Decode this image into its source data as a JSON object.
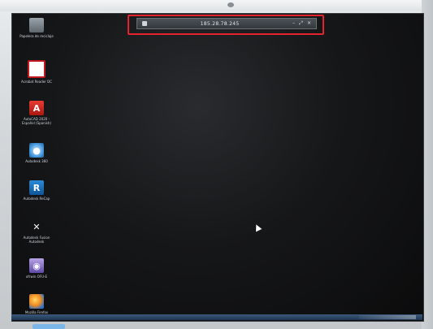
{
  "remote_bar": {
    "title": "185.28.78.245",
    "pin_label": "",
    "controls": [
      "–",
      "⤢",
      "×"
    ]
  },
  "desktop": {
    "icons": [
      {
        "key": "recycle-bin",
        "icon": "recycle-bin-icon",
        "label": "Papelera de reciclaje"
      },
      {
        "key": "acrobat-reader",
        "icon": "acrobat-reader-icon",
        "label": "Acrobat Reader DC"
      },
      {
        "key": "autocad",
        "icon": "autocad-icon",
        "label": "AutoCAD 2020 - Español (Spanish)"
      },
      {
        "key": "autodesk-360",
        "icon": "autodesk-360-icon",
        "label": "Autodesk 360"
      },
      {
        "key": "autodesk-recap",
        "icon": "autodesk-recap-icon",
        "label": "Autodesk ReCap"
      },
      {
        "key": "fusion",
        "icon": "fusion-icon",
        "label": "Autodesk Fusion Autodesk"
      },
      {
        "key": "ofrwin",
        "icon": "ofrwin-icon",
        "label": "ofrwin OFU-E"
      },
      {
        "key": "firefox",
        "icon": "firefox-icon",
        "label": "Mozilla Firefox"
      }
    ]
  },
  "colors": {
    "highlight": "#e4232c",
    "screen": "#111214",
    "taskbar": "#1e3552"
  }
}
